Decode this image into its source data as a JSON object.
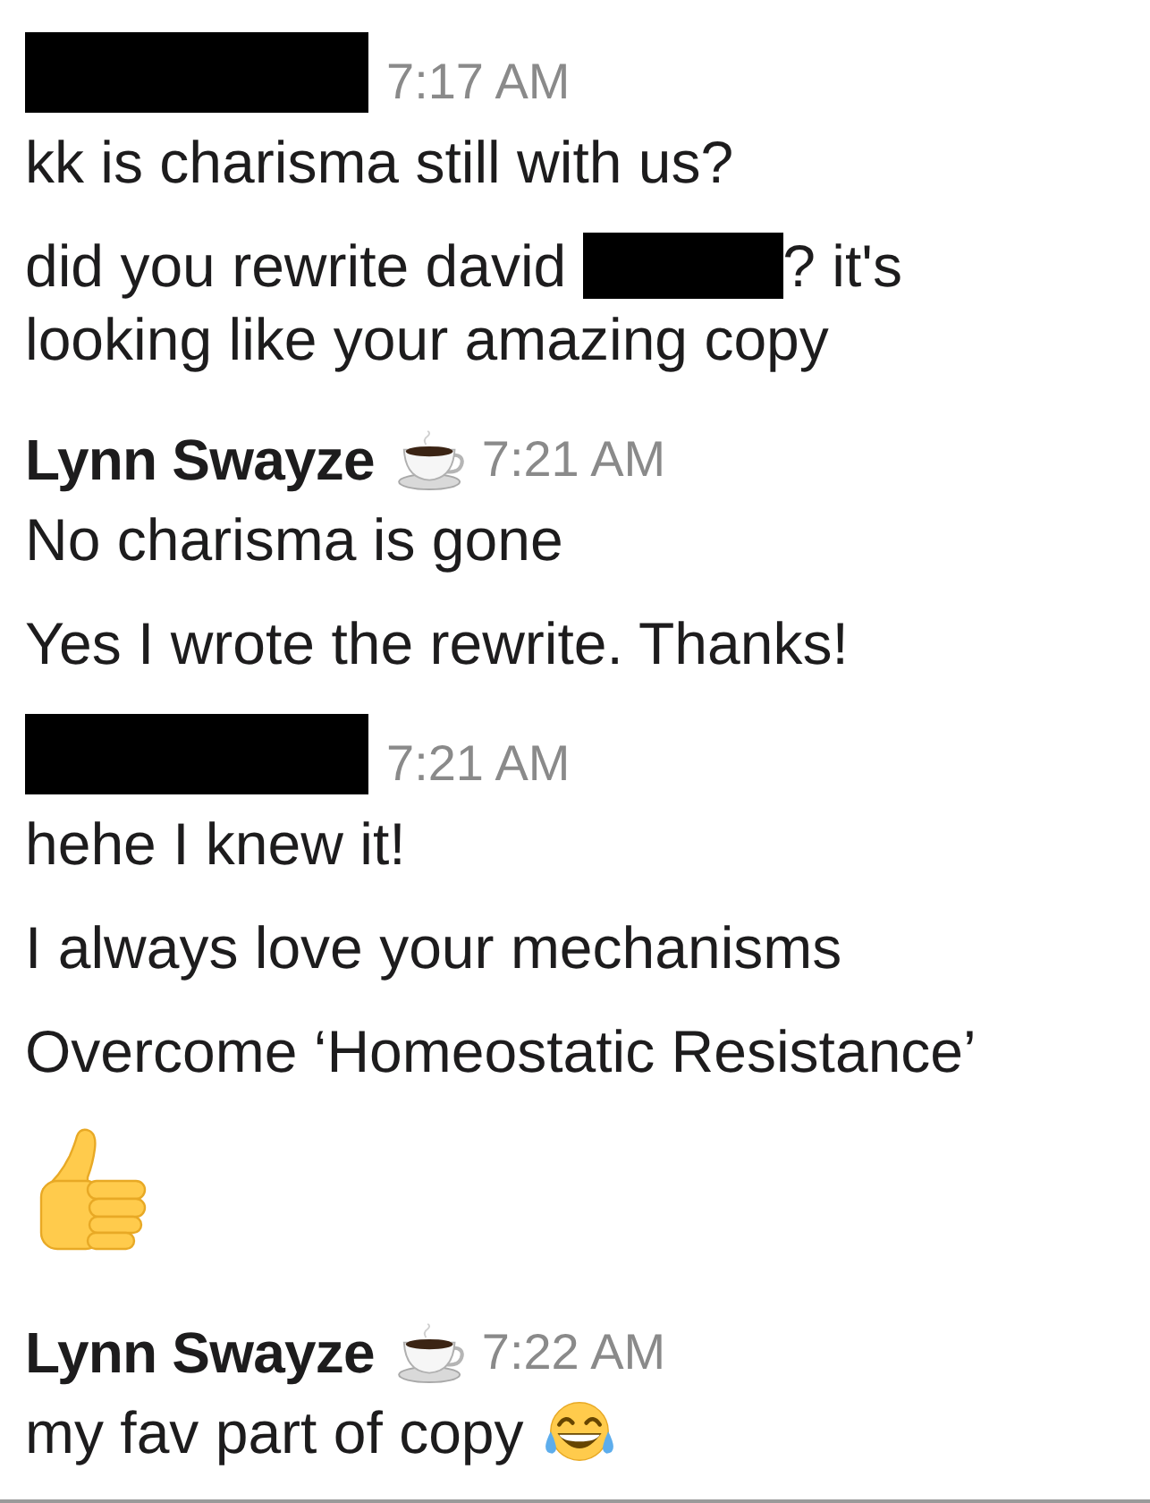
{
  "groups": [
    {
      "sender": {
        "kind": "redacted"
      },
      "time": "7:17 AM",
      "messages": [
        {
          "kind": "text",
          "text": "kk is charisma still with us?"
        },
        {
          "kind": "text_with_redaction",
          "before": "did you rewrite david",
          "after": "? it's",
          "next_line": "looking like your amazing copy"
        }
      ]
    },
    {
      "sender": {
        "kind": "named",
        "name": "Lynn Swayze",
        "status_icon": true
      },
      "time": "7:21 AM",
      "messages": [
        {
          "kind": "text",
          "text": "No charisma is gone"
        },
        {
          "kind": "text",
          "text": "Yes I wrote the rewrite. Thanks!"
        }
      ]
    },
    {
      "sender": {
        "kind": "redacted"
      },
      "time": "7:21 AM",
      "messages": [
        {
          "kind": "text",
          "text": "hehe I knew it!"
        },
        {
          "kind": "text",
          "text": "I always love your mechanisms"
        },
        {
          "kind": "text",
          "text": "Overcome ‘Homeostatic Resistance’"
        },
        {
          "kind": "big_emoji"
        }
      ]
    },
    {
      "sender": {
        "kind": "named",
        "name": "Lynn Swayze",
        "status_icon": true
      },
      "time": "7:22 AM",
      "messages": [
        {
          "kind": "text_with_emoji",
          "text": "my fav part of copy"
        }
      ]
    }
  ]
}
